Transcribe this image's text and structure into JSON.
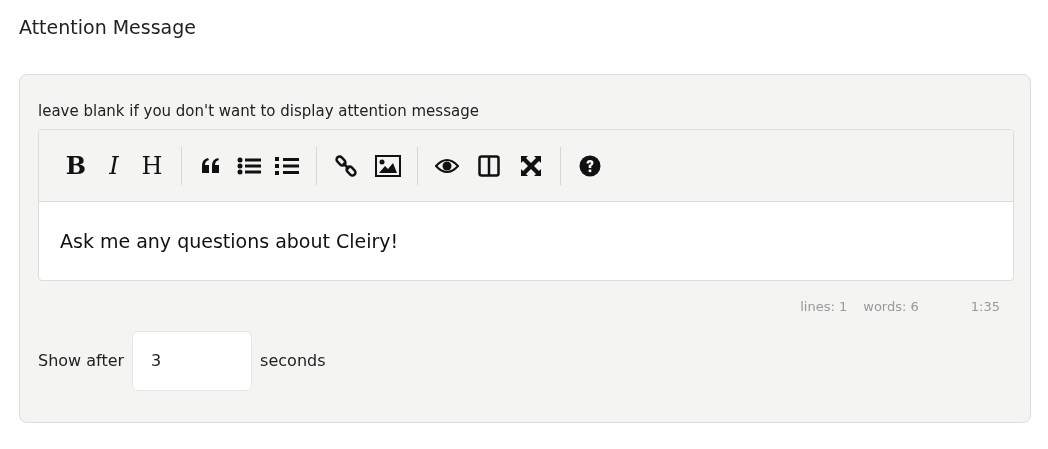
{
  "heading": "Attention Message",
  "hint": "leave blank if you don't want to display attention message",
  "toolbar": {
    "text_buttons": [
      "B",
      "I",
      "H"
    ]
  },
  "editor": {
    "value": "Ask me any questions about Cleiry!"
  },
  "status_bar": {
    "lines": "lines: 1",
    "words": "words: 6",
    "cursor": "1:35"
  },
  "delay": {
    "label": "Show after",
    "value": "3",
    "unit": "seconds"
  }
}
